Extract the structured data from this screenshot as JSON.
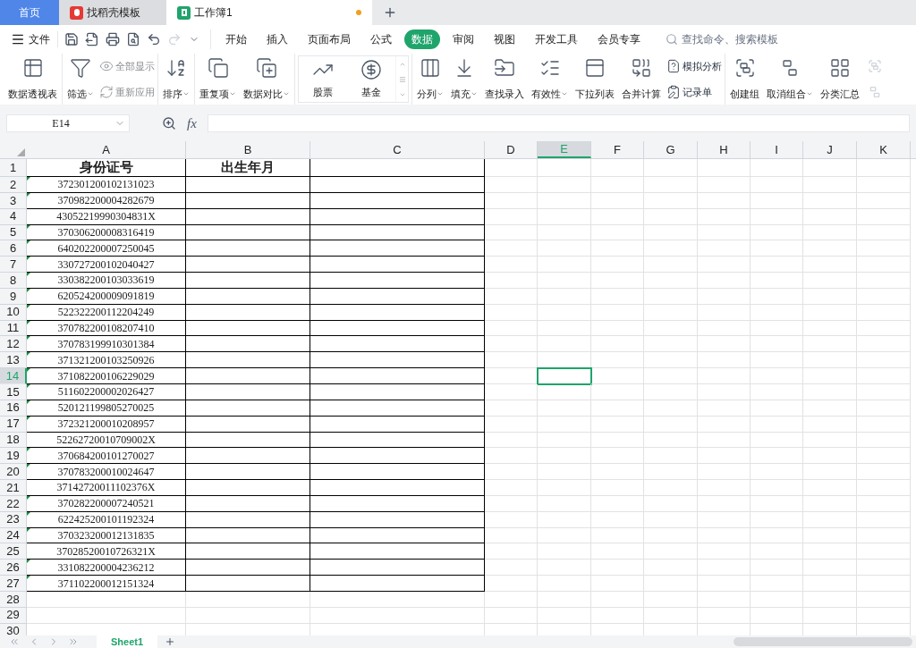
{
  "app_tabs": [
    {
      "label": "首页",
      "kind": "home",
      "selected": false
    },
    {
      "label": "找稻壳模板",
      "kind": "template",
      "selected": false
    },
    {
      "label": "工作簿1",
      "kind": "sheet",
      "selected": true,
      "unsaved": true
    }
  ],
  "file_menu": "文件",
  "ribbon_tabs": [
    {
      "label": "开始",
      "selected": false
    },
    {
      "label": "插入",
      "selected": false
    },
    {
      "label": "页面布局",
      "selected": false
    },
    {
      "label": "公式",
      "selected": false
    },
    {
      "label": "数据",
      "selected": true
    },
    {
      "label": "审阅",
      "selected": false
    },
    {
      "label": "视图",
      "selected": false
    },
    {
      "label": "开发工具",
      "selected": false
    },
    {
      "label": "会员专享",
      "selected": false
    }
  ],
  "search": {
    "placeholder": "查找命令、搜索模板"
  },
  "ribbon_groups": [
    [
      {
        "kind": "large",
        "label": "数据透视表",
        "dropdown": false
      }
    ],
    [
      {
        "kind": "large",
        "label": "筛选",
        "dropdown": true
      },
      {
        "kind": "stack",
        "items": [
          {
            "label": "全部显示",
            "disabled": true
          },
          {
            "label": "重新应用",
            "disabled": true
          }
        ]
      }
    ],
    [
      {
        "kind": "large",
        "label": "排序",
        "dropdown": true
      }
    ],
    [
      {
        "kind": "large",
        "label": "重复项",
        "dropdown": true
      },
      {
        "kind": "large",
        "label": "数据对比",
        "dropdown": true
      }
    ],
    [
      {
        "kind": "gallery",
        "items": [
          {
            "label": "股票"
          },
          {
            "label": "基金"
          }
        ]
      }
    ],
    [
      {
        "kind": "large",
        "label": "分列",
        "dropdown": true
      },
      {
        "kind": "large",
        "label": "填充",
        "dropdown": true
      },
      {
        "kind": "large",
        "label": "查找录入",
        "dropdown": false
      },
      {
        "kind": "large",
        "label": "有效性",
        "dropdown": true
      },
      {
        "kind": "large",
        "label": "下拉列表",
        "dropdown": false
      },
      {
        "kind": "large",
        "label": "合并计算",
        "dropdown": false
      },
      {
        "kind": "stack",
        "items": [
          {
            "label": "模拟分析",
            "disabled": false
          },
          {
            "label": "记录单",
            "disabled": false
          }
        ]
      }
    ],
    [
      {
        "kind": "large",
        "label": "创建组",
        "dropdown": false
      },
      {
        "kind": "large",
        "label": "取消组合",
        "dropdown": true
      },
      {
        "kind": "large",
        "label": "分类汇总",
        "dropdown": false
      }
    ]
  ],
  "name_box": "E14",
  "function_label": "fx",
  "columns": [
    {
      "label": "A",
      "selected": false
    },
    {
      "label": "B",
      "selected": false
    },
    {
      "label": "C",
      "selected": false
    },
    {
      "label": "D",
      "selected": false
    },
    {
      "label": "E",
      "selected": true
    },
    {
      "label": "F",
      "selected": false
    },
    {
      "label": "G",
      "selected": false
    },
    {
      "label": "H",
      "selected": false
    },
    {
      "label": "I",
      "selected": false
    },
    {
      "label": "J",
      "selected": false
    },
    {
      "label": "K",
      "selected": false
    }
  ],
  "rows": [
    {
      "number": "1",
      "selected": false,
      "bordered": true,
      "header": true,
      "a": "身份证号",
      "b": "出生年月"
    },
    {
      "number": "2",
      "selected": false,
      "bordered": true,
      "flag": true,
      "a": "372301200102131023"
    },
    {
      "number": "3",
      "selected": false,
      "bordered": true,
      "flag": true,
      "a": "370982200004282679"
    },
    {
      "number": "4",
      "selected": false,
      "bordered": true,
      "flag": false,
      "a": "43052219990304831X"
    },
    {
      "number": "5",
      "selected": false,
      "bordered": true,
      "flag": true,
      "a": "370306200008316419"
    },
    {
      "number": "6",
      "selected": false,
      "bordered": true,
      "flag": true,
      "a": "640202200007250045"
    },
    {
      "number": "7",
      "selected": false,
      "bordered": true,
      "flag": true,
      "a": "330727200102040427"
    },
    {
      "number": "8",
      "selected": false,
      "bordered": true,
      "flag": true,
      "a": "330382200103033619"
    },
    {
      "number": "9",
      "selected": false,
      "bordered": true,
      "flag": true,
      "a": "620524200009091819"
    },
    {
      "number": "10",
      "selected": false,
      "bordered": true,
      "flag": true,
      "a": "522322200112204249"
    },
    {
      "number": "11",
      "selected": false,
      "bordered": true,
      "flag": true,
      "a": "370782200108207410"
    },
    {
      "number": "12",
      "selected": false,
      "bordered": true,
      "flag": true,
      "a": "370783199910301384"
    },
    {
      "number": "13",
      "selected": false,
      "bordered": true,
      "flag": true,
      "a": "371321200103250926"
    },
    {
      "number": "14",
      "selected": true,
      "bordered": true,
      "flag": true,
      "a": "371082200106229029"
    },
    {
      "number": "15",
      "selected": false,
      "bordered": true,
      "flag": true,
      "a": "511602200002026427"
    },
    {
      "number": "16",
      "selected": false,
      "bordered": true,
      "flag": true,
      "a": "520121199805270025"
    },
    {
      "number": "17",
      "selected": false,
      "bordered": true,
      "flag": true,
      "a": "372321200010208957"
    },
    {
      "number": "18",
      "selected": false,
      "bordered": true,
      "flag": false,
      "a": "52262720010709002X"
    },
    {
      "number": "19",
      "selected": false,
      "bordered": true,
      "flag": true,
      "a": "370684200101270027"
    },
    {
      "number": "20",
      "selected": false,
      "bordered": true,
      "flag": true,
      "a": "370783200010024647"
    },
    {
      "number": "21",
      "selected": false,
      "bordered": true,
      "flag": false,
      "a": "37142720011102376X"
    },
    {
      "number": "22",
      "selected": false,
      "bordered": true,
      "flag": true,
      "a": "370282200007240521"
    },
    {
      "number": "23",
      "selected": false,
      "bordered": true,
      "flag": true,
      "a": "622425200101192324"
    },
    {
      "number": "24",
      "selected": false,
      "bordered": true,
      "flag": true,
      "a": "370323200012131835"
    },
    {
      "number": "25",
      "selected": false,
      "bordered": true,
      "flag": false,
      "a": "37028520010726321X"
    },
    {
      "number": "26",
      "selected": false,
      "bordered": true,
      "flag": true,
      "a": "331082200004236212"
    },
    {
      "number": "27",
      "selected": false,
      "bordered": true,
      "flag": true,
      "a": "371102200012151324"
    },
    {
      "number": "28",
      "selected": false,
      "bordered": false
    },
    {
      "number": "29",
      "selected": false,
      "bordered": false
    },
    {
      "number": "30",
      "selected": false,
      "bordered": false
    }
  ],
  "sheet_tabs": [
    {
      "label": "Sheet1",
      "selected": true
    }
  ]
}
